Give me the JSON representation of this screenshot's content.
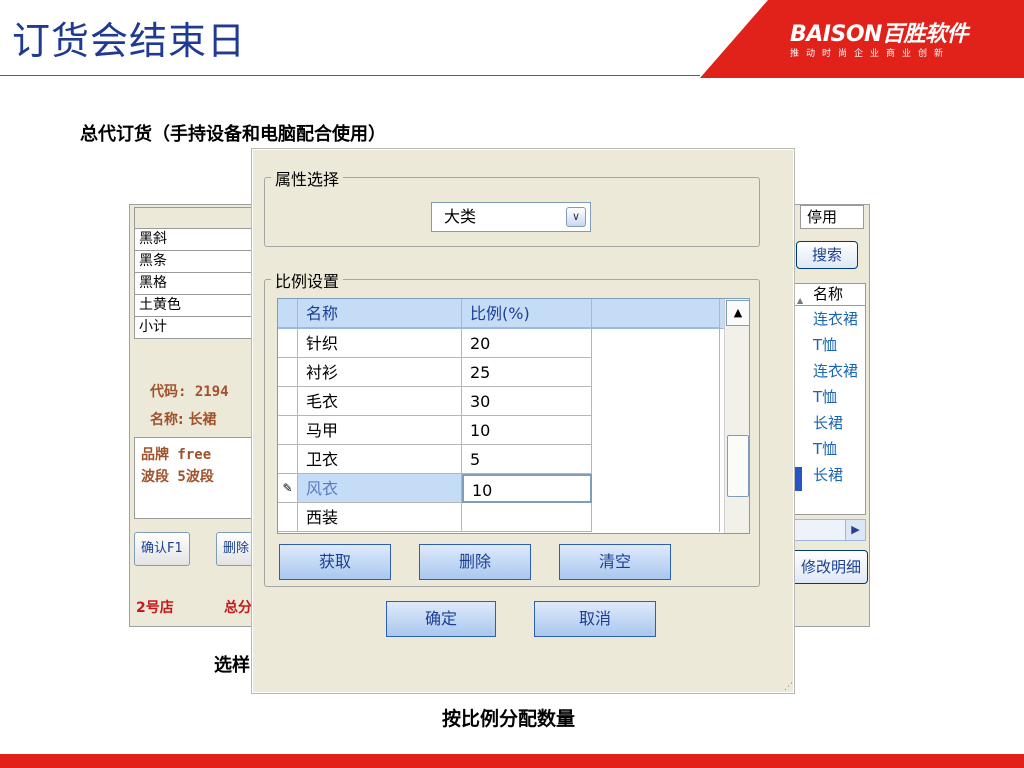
{
  "slide": {
    "title": "订货会结束日",
    "subtitle": "总代订货（手持设备和电脑配合使用）",
    "cut_label": "选样",
    "caption": "按比例分配数量",
    "logo_main": "BAISON百胜软件",
    "logo_sub": "推动时尚企业商业创新",
    "accent_color": "#e0221a"
  },
  "bgwindow": {
    "left_rows": [
      "",
      "黑斜",
      "黑条",
      "黑格",
      "土黄色",
      "小计"
    ],
    "code_label": "代码: 2194",
    "name_label": "名称: 长裙",
    "info_lines": [
      "品牌  free",
      "波段  5波段"
    ],
    "confirm_button": "确认F1",
    "delete_button": "删除",
    "store": "2号店",
    "total": "总分",
    "stop_label": "停用",
    "search_button": "搜索",
    "list_header": "名称",
    "list_items": [
      "连衣裙",
      "T恤",
      "连衣裙",
      "T恤",
      "长裙",
      "T恤",
      "长裙"
    ],
    "modify_button": "修改明细"
  },
  "dialog": {
    "attr_group_title": "属性选择",
    "attr_select_value": "大类",
    "ratio_group_title": "比例设置",
    "grid_headers": {
      "name": "名称",
      "ratio": "比例(%)"
    },
    "rows": [
      {
        "name": "针织",
        "ratio": "20"
      },
      {
        "name": "衬衫",
        "ratio": "25"
      },
      {
        "name": "毛衣",
        "ratio": "30"
      },
      {
        "name": "马甲",
        "ratio": "10"
      },
      {
        "name": "卫衣",
        "ratio": "5"
      },
      {
        "name": "风衣",
        "ratio": "10"
      },
      {
        "name": "西装",
        "ratio": ""
      }
    ],
    "buttons": {
      "fetch": "获取",
      "delete": "删除",
      "clear": "清空",
      "ok": "确定",
      "cancel": "取消"
    },
    "edit_indicator": "✎",
    "scroll_up_glyph": "▲"
  }
}
